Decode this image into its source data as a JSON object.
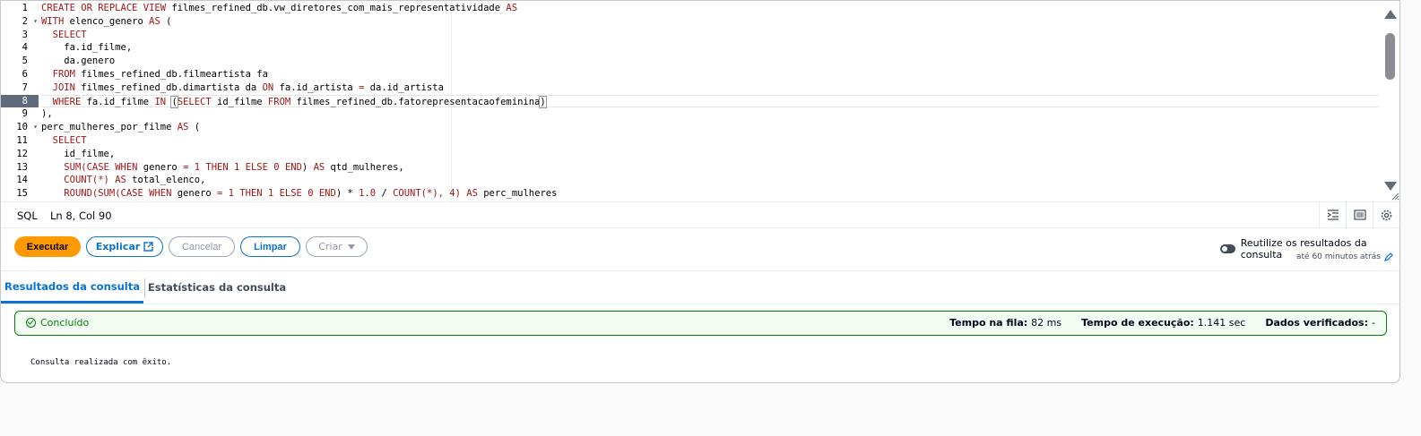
{
  "editor": {
    "line_numbers": [
      "1",
      "2",
      "3",
      "4",
      "5",
      "6",
      "7",
      "8",
      "9",
      "10",
      "11",
      "12",
      "13",
      "14",
      "15"
    ],
    "active_line": 8,
    "fold_lines": [
      2,
      10
    ]
  },
  "code": [
    [
      {
        "t": "CREATE OR REPLACE VIEW",
        "k": 1
      },
      {
        "t": " filmes_refined_db.vw_diretores_com_mais_representatividade "
      },
      {
        "t": "AS",
        "k": 1
      }
    ],
    [
      {
        "t": "WITH",
        "k": 1
      },
      {
        "t": " elenco_genero "
      },
      {
        "t": "AS",
        "k": 1
      },
      {
        "t": " ("
      }
    ],
    [
      {
        "t": "  "
      },
      {
        "t": "SELECT",
        "k": 1
      }
    ],
    [
      {
        "t": "    fa.id_filme,"
      }
    ],
    [
      {
        "t": "    da.genero"
      }
    ],
    [
      {
        "t": "  "
      },
      {
        "t": "FROM",
        "k": 1
      },
      {
        "t": " filmes_refined_db.filmeartista fa"
      }
    ],
    [
      {
        "t": "  "
      },
      {
        "t": "JOIN",
        "k": 1
      },
      {
        "t": " filmes_refined_db.dimartista da "
      },
      {
        "t": "ON",
        "k": 1
      },
      {
        "t": " fa.id_artista "
      },
      {
        "t": "=",
        "k": 1
      },
      {
        "t": " da.id_artista"
      }
    ],
    [
      {
        "t": "  "
      },
      {
        "t": "WHERE",
        "k": 1
      },
      {
        "t": " fa.id_filme "
      },
      {
        "t": "IN",
        "k": 1
      },
      {
        "t": " "
      },
      {
        "t": "(",
        "b": 1
      },
      {
        "t": "SELECT",
        "k": 1
      },
      {
        "t": " id_filme "
      },
      {
        "t": "FROM",
        "k": 1
      },
      {
        "t": " filmes_refined_db.fatorepresentacaofeminina"
      },
      {
        "t": ")",
        "b": 1
      }
    ],
    [
      {
        "t": "),"
      }
    ],
    [
      {
        "t": "perc_mulheres_por_filme "
      },
      {
        "t": "AS",
        "k": 1
      },
      {
        "t": " ("
      }
    ],
    [
      {
        "t": "  "
      },
      {
        "t": "SELECT",
        "k": 1
      }
    ],
    [
      {
        "t": "    id_filme,"
      }
    ],
    [
      {
        "t": "    "
      },
      {
        "t": "SUM(CASE WHEN",
        "k": 1
      },
      {
        "t": " genero "
      },
      {
        "t": "=",
        "k": 1
      },
      {
        "t": " "
      },
      {
        "t": "1",
        "k": 1
      },
      {
        "t": " "
      },
      {
        "t": "THEN",
        "k": 1
      },
      {
        "t": " "
      },
      {
        "t": "1",
        "k": 1
      },
      {
        "t": " "
      },
      {
        "t": "ELSE",
        "k": 1
      },
      {
        "t": " "
      },
      {
        "t": "0",
        "k": 1
      },
      {
        "t": " "
      },
      {
        "t": "END",
        "k": 1
      },
      {
        "t": ") "
      },
      {
        "t": "AS",
        "k": 1
      },
      {
        "t": " qtd_mulheres,"
      }
    ],
    [
      {
        "t": "    "
      },
      {
        "t": "COUNT(*)",
        "k": 1
      },
      {
        "t": " "
      },
      {
        "t": "AS",
        "k": 1
      },
      {
        "t": " total_elenco,"
      }
    ],
    [
      {
        "t": "    "
      },
      {
        "t": "ROUND(SUM(CASE WHEN",
        "k": 1
      },
      {
        "t": " genero "
      },
      {
        "t": "=",
        "k": 1
      },
      {
        "t": " "
      },
      {
        "t": "1",
        "k": 1
      },
      {
        "t": " "
      },
      {
        "t": "THEN",
        "k": 1
      },
      {
        "t": " "
      },
      {
        "t": "1",
        "k": 1
      },
      {
        "t": " "
      },
      {
        "t": "ELSE",
        "k": 1
      },
      {
        "t": " "
      },
      {
        "t": "0",
        "k": 1
      },
      {
        "t": " "
      },
      {
        "t": "END",
        "k": 1
      },
      {
        "t": ") * "
      },
      {
        "t": "1.0",
        "k": 1
      },
      {
        "t": " / "
      },
      {
        "t": "COUNT(*), 4)",
        "k": 1
      },
      {
        "t": " "
      },
      {
        "t": "AS",
        "k": 1
      },
      {
        "t": " perc_mulheres"
      }
    ]
  ],
  "statusbar": {
    "language": "SQL",
    "position": "Ln 8, Col 90",
    "icons": [
      "indent-icon",
      "wrap-icon",
      "settings-icon"
    ]
  },
  "actions": {
    "run": "Executar",
    "explain": "Explicar",
    "cancel": "Cancelar",
    "clear": "Limpar",
    "create": "Criar"
  },
  "reuse": {
    "label": "Reutilize os resultados da consulta",
    "sub": "até 60 minutos atrás"
  },
  "tabs": {
    "results": "Resultados da consulta",
    "stats": "Estatísticas da consulta"
  },
  "alert": {
    "status": "Concluído",
    "queue_label": "Tempo na fila:",
    "queue_value": "82 ms",
    "exec_label": "Tempo de execução:",
    "exec_value": "1.141 sec",
    "scanned_label": "Dados verificados:",
    "scanned_value": "-"
  },
  "result_message": "Consulta realizada com êxito.",
  "colors": {
    "accent": "#0972d3",
    "primary": "#ff9900",
    "success": "#037f0c",
    "keyword": "#a31515"
  }
}
